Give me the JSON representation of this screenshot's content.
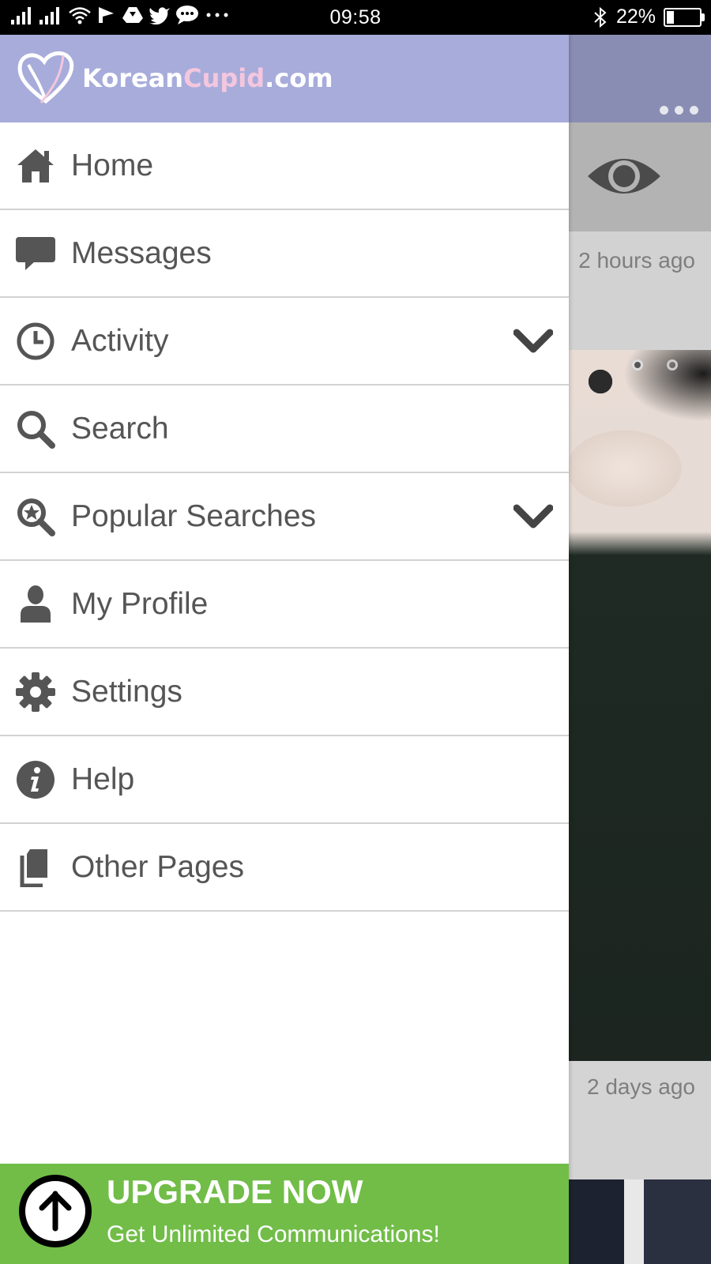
{
  "status_bar": {
    "time": "09:58",
    "battery": "22%",
    "battery_level": 0.22,
    "left_icons": [
      "signal-icon",
      "signal-icon",
      "wifi-icon",
      "flag-icon",
      "drive-icon",
      "twitter-icon",
      "chat-icon",
      "more-dots-icon"
    ],
    "right_icons": [
      "bluetooth-icon",
      "battery-icon"
    ]
  },
  "app": {
    "logo_prefix": "Korean",
    "logo_highlight": "Cupid",
    "logo_suffix": ".com",
    "header_color": "#a7acdb",
    "overflow_menu_icon": "more-dots-icon"
  },
  "menu": {
    "items": [
      {
        "label": "Home",
        "icon": "home-icon",
        "expandable": false
      },
      {
        "label": "Messages",
        "icon": "message-icon",
        "expandable": false
      },
      {
        "label": "Activity",
        "icon": "clock-icon",
        "expandable": true
      },
      {
        "label": "Search",
        "icon": "search-icon",
        "expandable": false
      },
      {
        "label": "Popular Searches",
        "icon": "star-search-icon",
        "expandable": true
      },
      {
        "label": "My Profile",
        "icon": "user-icon",
        "expandable": false
      },
      {
        "label": "Settings",
        "icon": "gear-icon",
        "expandable": false
      },
      {
        "label": "Help",
        "icon": "info-icon",
        "expandable": false
      },
      {
        "label": "Other Pages",
        "icon": "pages-icon",
        "expandable": false
      }
    ]
  },
  "upgrade": {
    "title": "UPGRADE NOW",
    "subtitle": "Get Unlimited Communications!",
    "color": "#71bd48",
    "icon": "upload-arrow-icon"
  },
  "background": {
    "card1_time": "2 hours ago",
    "card2_time": "2 days ago",
    "eye_icon": "eye-icon"
  }
}
